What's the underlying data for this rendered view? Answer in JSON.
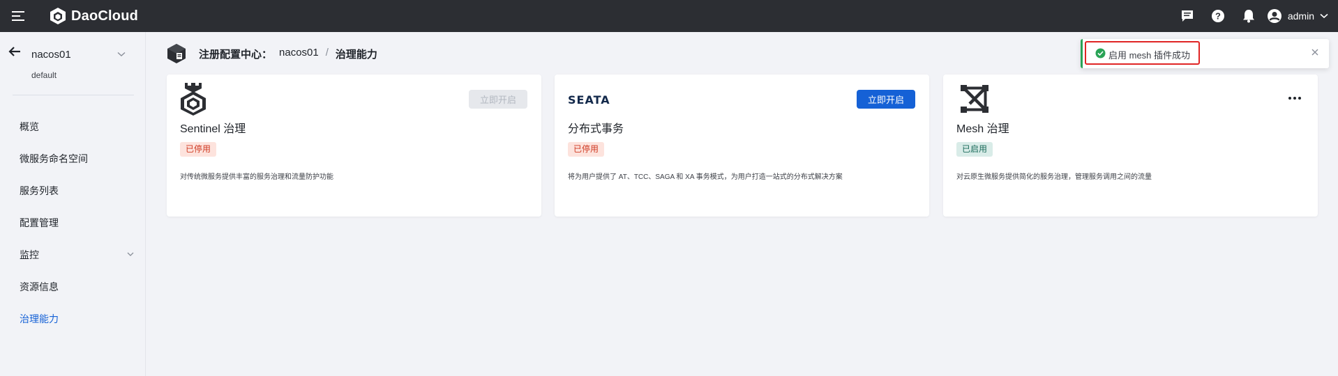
{
  "brand": {
    "name": "DaoCloud"
  },
  "header": {
    "user": "admin"
  },
  "sidebar": {
    "workspace": "nacos01",
    "namespace": "default",
    "items": [
      {
        "label": "概览"
      },
      {
        "label": "微服务命名空间"
      },
      {
        "label": "服务列表"
      },
      {
        "label": "配置管理"
      },
      {
        "label": "监控"
      },
      {
        "label": "资源信息"
      },
      {
        "label": "治理能力"
      }
    ]
  },
  "breadcrumb": {
    "prefix": "注册配置中心：",
    "instance": "nacos01",
    "separator": "/",
    "current": "治理能力"
  },
  "cards": [
    {
      "title": "Sentinel 治理",
      "status": "已停用",
      "button": "立即开启",
      "description": "对传统微服务提供丰富的服务治理和流量防护功能"
    },
    {
      "title": "分布式事务",
      "status": "已停用",
      "button": "立即开启",
      "description": "将为用户提供了 AT、TCC、SAGA 和 XA 事务模式，为用户打造一站式的分布式解决方案",
      "logo_text": "SEATA"
    },
    {
      "title": "Mesh 治理",
      "status": "已启用",
      "description": "对云原生微服务提供简化的服务治理，管理服务调用之间的流量"
    }
  ],
  "toast": {
    "message": "启用 mesh 插件成功"
  },
  "colors": {
    "primary": "#1561d6",
    "topbar": "#2c2e33",
    "success": "#29a356",
    "danger": "#cf3a22"
  }
}
